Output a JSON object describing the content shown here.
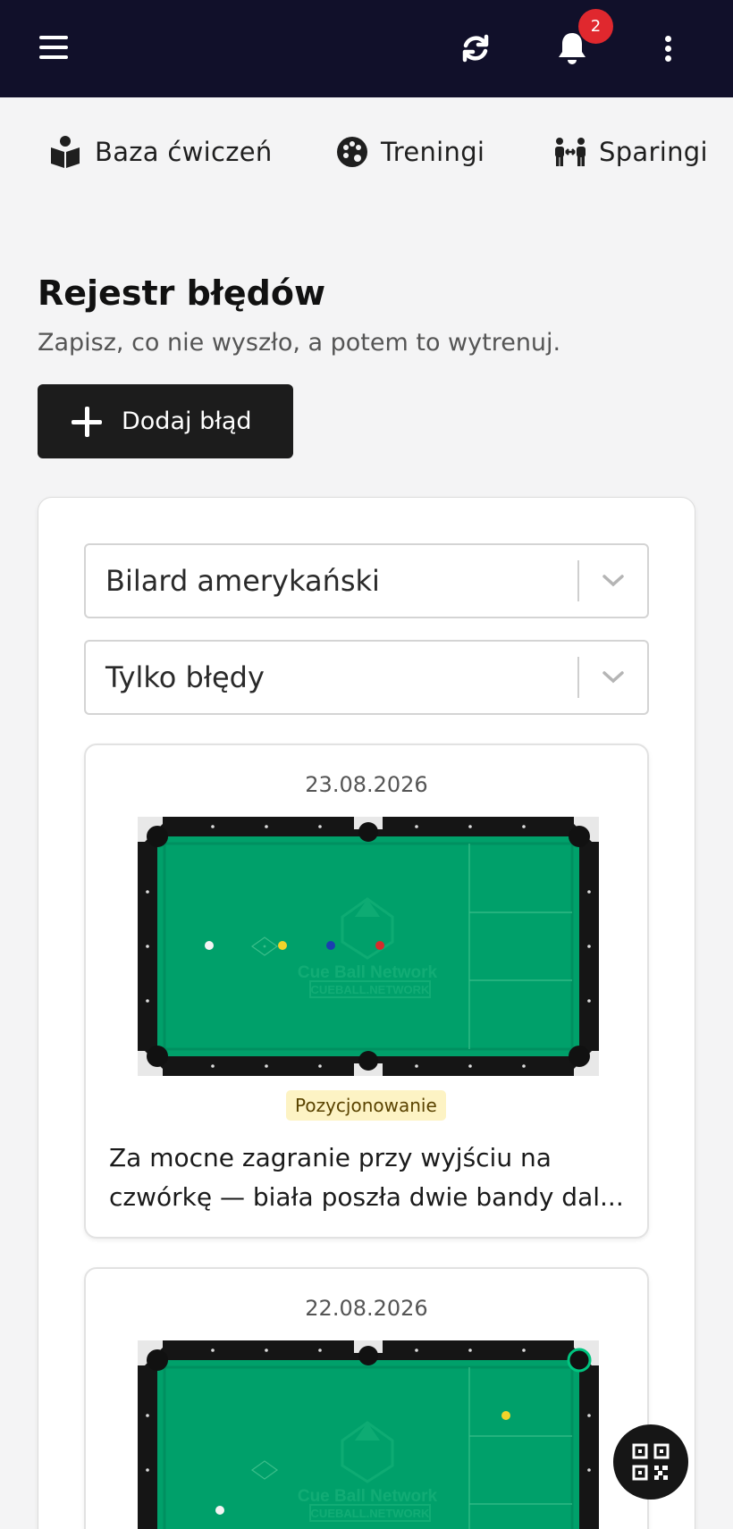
{
  "topbar": {
    "notifications_count": "2"
  },
  "nav": {
    "tabs": [
      {
        "label": "Baza ćwiczeń",
        "icon": "book-reader-icon"
      },
      {
        "label": "Treningi",
        "icon": "palette-icon"
      },
      {
        "label": "Sparingi",
        "icon": "people-arrows-icon"
      }
    ]
  },
  "section": {
    "title": "Rejestr błędów",
    "subtitle": "Zapisz, co nie wyszło, a potem to wytrenuj.",
    "add_button_label": "Dodaj błąd"
  },
  "filters": {
    "game_select": "Bilard amerykański",
    "type_select": "Tylko błędy"
  },
  "cards": [
    {
      "date": "23.08.2026",
      "tag": "Pozycjonowanie",
      "note_line1": "Za mocne zagranie przy wyjściu na",
      "note_line2": "czwórkę — biała poszła dwie bandy dal..."
    },
    {
      "date": "22.08.2026"
    }
  ],
  "table_watermark": {
    "line1": "Cue Ball Network",
    "line2": "CUEBALL.NETWORK"
  },
  "colors": {
    "topbar": "#11102a",
    "badge": "#e0282e",
    "felt": "#00a06a",
    "button": "#1c1c1c",
    "tag_bg": "#fdf3c4"
  }
}
